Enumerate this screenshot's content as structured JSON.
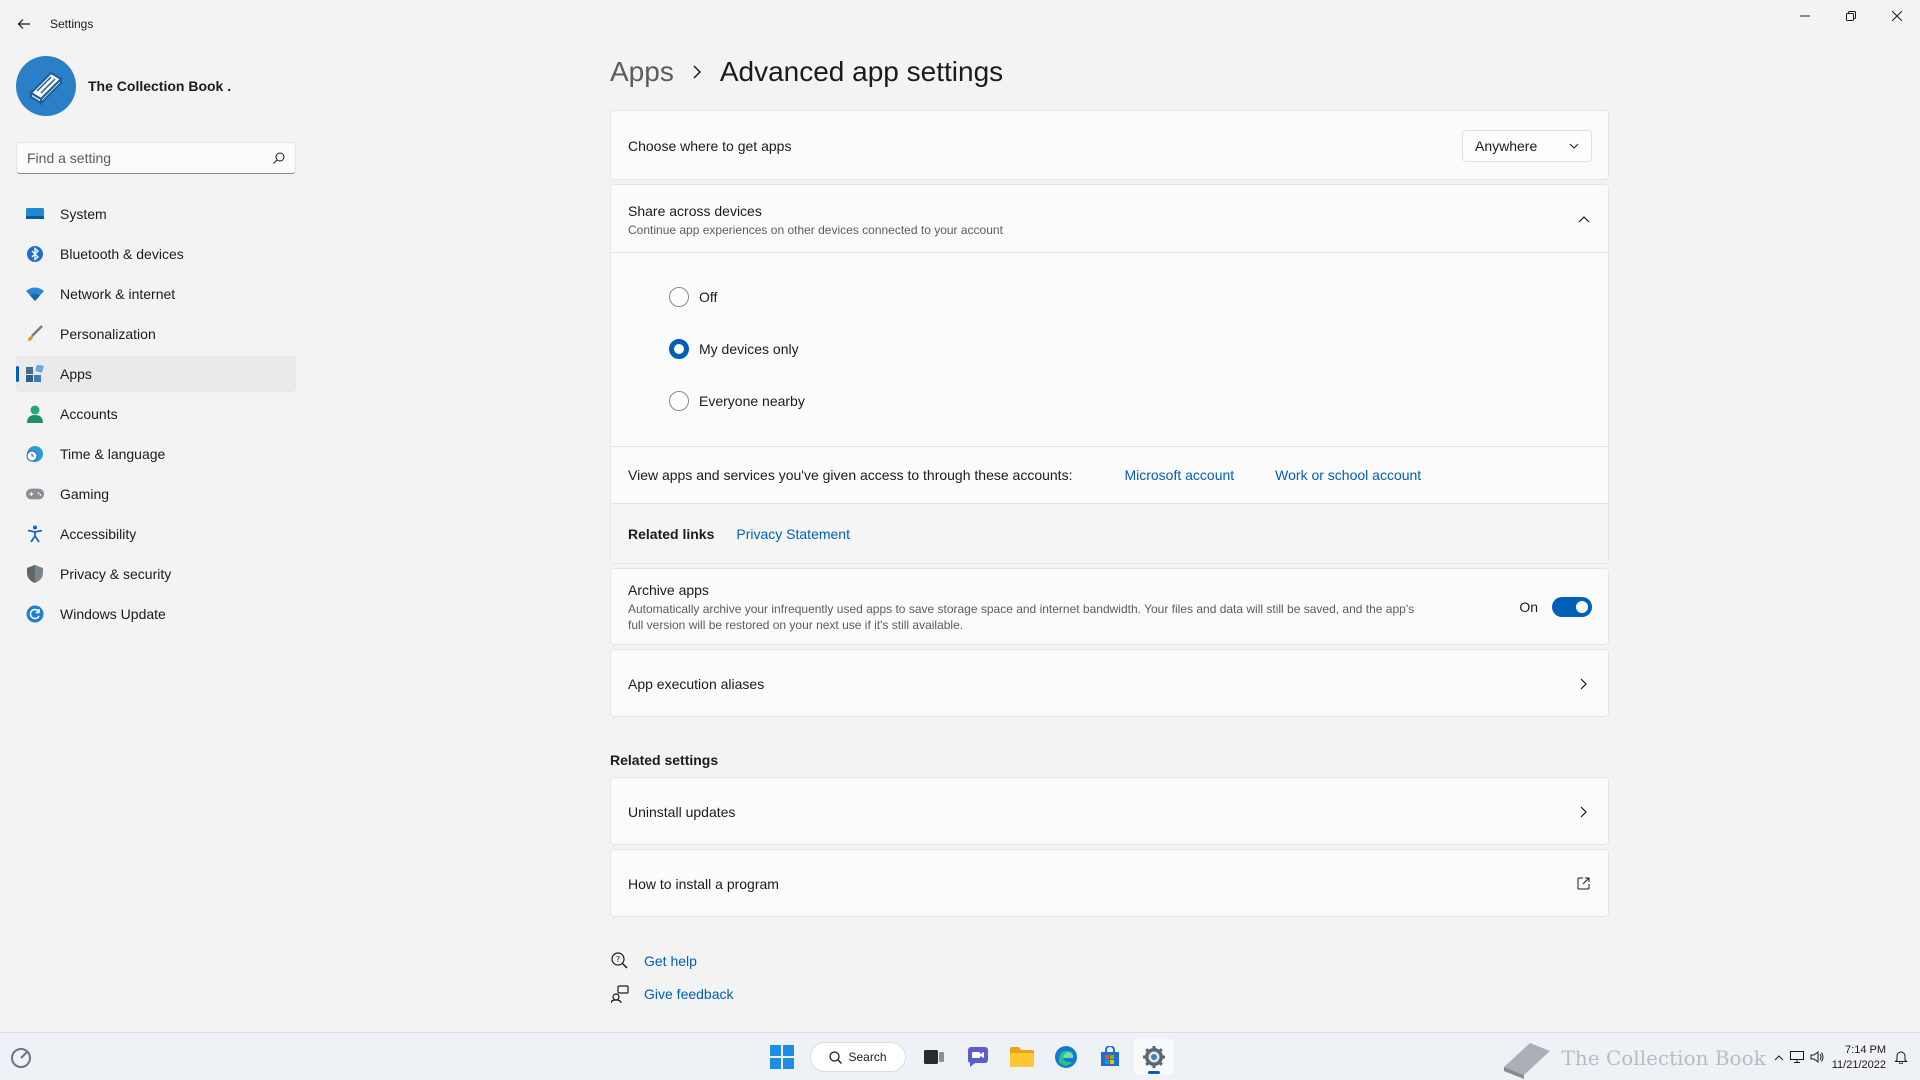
{
  "window": {
    "title": "Settings"
  },
  "profile": {
    "name": "The Collection Book ."
  },
  "search": {
    "placeholder": "Find a setting"
  },
  "nav": {
    "items": [
      {
        "label": "System",
        "icon": "monitor-icon"
      },
      {
        "label": "Bluetooth & devices",
        "icon": "bluetooth-icon"
      },
      {
        "label": "Network & internet",
        "icon": "wifi-icon"
      },
      {
        "label": "Personalization",
        "icon": "brush-icon"
      },
      {
        "label": "Apps",
        "icon": "apps-icon",
        "active": true
      },
      {
        "label": "Accounts",
        "icon": "person-icon"
      },
      {
        "label": "Time & language",
        "icon": "globe-clock-icon"
      },
      {
        "label": "Gaming",
        "icon": "gamepad-icon"
      },
      {
        "label": "Accessibility",
        "icon": "accessibility-icon"
      },
      {
        "label": "Privacy & security",
        "icon": "shield-icon"
      },
      {
        "label": "Windows Update",
        "icon": "update-icon"
      }
    ]
  },
  "breadcrumb": {
    "parent": "Apps",
    "current": "Advanced app settings"
  },
  "get_apps": {
    "label": "Choose where to get apps",
    "value": "Anywhere"
  },
  "share": {
    "title": "Share across devices",
    "subtitle": "Continue app experiences on other devices connected to your account",
    "options": [
      {
        "label": "Off",
        "checked": false
      },
      {
        "label": "My devices only",
        "checked": true
      },
      {
        "label": "Everyone nearby",
        "checked": false
      }
    ],
    "accounts_text": "View apps and services you've given access to through these accounts:",
    "microsoft_account": "Microsoft account",
    "work_account": "Work or school account",
    "related_links_label": "Related links",
    "privacy_statement": "Privacy Statement"
  },
  "archive": {
    "title": "Archive apps",
    "description": "Automatically archive your infrequently used apps to save storage space and internet bandwidth. Your files and data will still be saved, and the app's full version will be restored on your next use if it's still available.",
    "state": "On"
  },
  "aliases": {
    "label": "App execution aliases"
  },
  "related_settings": {
    "title": "Related settings",
    "uninstall": "Uninstall updates",
    "install_program": "How to install a program"
  },
  "help": {
    "get_help": "Get help",
    "give_feedback": "Give feedback"
  },
  "taskbar": {
    "search_label": "Search",
    "time": "7:14 PM",
    "date": "11/21/2022",
    "watermark": "The Collection Book"
  },
  "colors": {
    "accent": "#005fb8",
    "background": "#f3f3f3",
    "card": "#fbfbfb"
  }
}
